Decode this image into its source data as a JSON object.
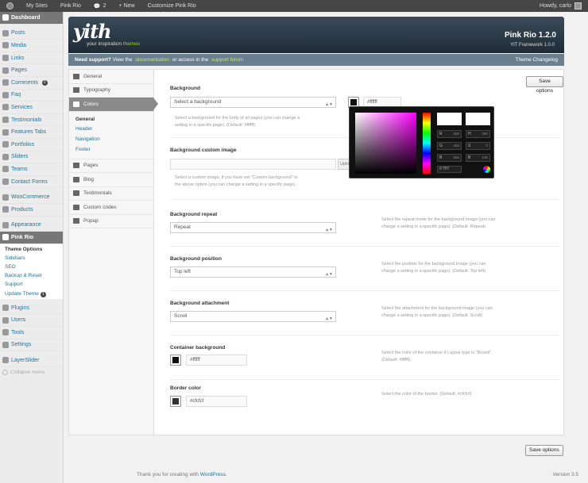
{
  "adminbar": {
    "my_sites": "My Sites",
    "site_name": "Pink Rio",
    "comments": "2",
    "new": "+ New",
    "customize": "Customize Pink Rio",
    "howdy": "Howdy, carlo"
  },
  "sidebar": {
    "items": [
      {
        "label": "Dashboard",
        "icon": "dashboard-icon"
      },
      {
        "label": "Posts",
        "icon": "pin-icon"
      },
      {
        "label": "Media",
        "icon": "media-icon"
      },
      {
        "label": "Links",
        "icon": "links-icon"
      },
      {
        "label": "Pages",
        "icon": "pages-icon"
      },
      {
        "label": "Comments",
        "icon": "comments-icon",
        "badge": "2"
      },
      {
        "label": "Faq",
        "icon": "question-icon"
      },
      {
        "label": "Services",
        "icon": "gear-icon"
      },
      {
        "label": "Testimonials",
        "icon": "quote-icon"
      },
      {
        "label": "Features Tabs",
        "icon": "tabs-icon"
      },
      {
        "label": "Portfolios",
        "icon": "folder-icon"
      },
      {
        "label": "Sliders",
        "icon": "slider-icon"
      },
      {
        "label": "Teams",
        "icon": "team-icon"
      },
      {
        "label": "Contact Forms",
        "icon": "mail-icon"
      },
      {
        "label": "WooCommerce",
        "icon": "woocommerce-icon"
      },
      {
        "label": "Products",
        "icon": "products-icon"
      },
      {
        "label": "Appearance",
        "icon": "appearance-icon"
      },
      {
        "label": "Pink Rio",
        "icon": "yith-icon"
      }
    ],
    "submenu": [
      "Theme Options",
      "Sidebars",
      "SEO",
      "Backup & Reset",
      "Support",
      "Update Theme"
    ],
    "update_badge": "1",
    "bottom": [
      {
        "label": "Plugins",
        "icon": "plugin-icon"
      },
      {
        "label": "Users",
        "icon": "users-icon"
      },
      {
        "label": "Tools",
        "icon": "tools-icon"
      },
      {
        "label": "Settings",
        "icon": "settings-icon"
      },
      {
        "label": "LayerSlider",
        "icon": "layerslider-icon"
      }
    ],
    "collapse": "Collapse menu"
  },
  "header": {
    "logo": "yith",
    "tagline_a": "your inspiration ",
    "tagline_b": "themes",
    "theme_version": "Pink Rio 1.2.0",
    "fw_version": "YIT Framework 1.0.0"
  },
  "support": {
    "lead": "Need support?",
    "text1": " View the ",
    "doc": "documentation",
    "text2": " or access in the ",
    "forum": "support forum",
    "changelog": "Theme Changelog"
  },
  "nav": {
    "general": "General",
    "typography": "Typography",
    "colors": "Colors",
    "sub": [
      "General",
      "Header",
      "Navigation",
      "Footer"
    ],
    "pages": "Pages",
    "blog": "Blog",
    "testimonials": "Testimonials",
    "custom_codes": "Custom codes",
    "popup": "Popup"
  },
  "buttons": {
    "save": "Save options"
  },
  "options": {
    "bg": {
      "title": "Background",
      "select": "Select a background",
      "desc": "Select a background for the body of all pages (you can change a setting in a specific page). (Default: #ffffff)",
      "color": "#ffffff"
    },
    "bg_image": {
      "title": "Background custom image",
      "upload": "Upload",
      "desc": "Select a custom image, if you have set \"Custom background\" in the above option (you can change a setting in a specific page)."
    },
    "bg_repeat": {
      "title": "Background repeat",
      "value": "Repeat",
      "desc": "Select the repeat mode for the background image (you can change a setting in a specific page). (Default: Repeat)"
    },
    "bg_position": {
      "title": "Background position",
      "value": "Top left",
      "desc": "Select the position for the background image (you can change a setting in a specific page). (Default: Top left)"
    },
    "bg_attach": {
      "title": "Background attachment",
      "value": "Scroll",
      "desc": "Select the attachment for the background image (you can change a setting in a specific page). (Default: Scroll)"
    },
    "container_bg": {
      "title": "Container background",
      "value": "#ffffff",
      "desc": "Select the color of the container if Layout type is \"Boxed\". (Default: #ffffff)"
    },
    "border": {
      "title": "Border color",
      "value": "#cfcfcf",
      "desc": "Select the color of the border. (Default: #cfcfcf)"
    }
  },
  "picker": {
    "r": "255",
    "g": "255",
    "b": "255",
    "h": "360",
    "s": "0",
    "b2": "100",
    "r_l": "R",
    "g_l": "G",
    "b_l": "B",
    "h_l": "H",
    "s_l": "S",
    "b2_l": "B",
    "hex": "#",
    "hex_val": "ffffff"
  },
  "footer": {
    "text": "Thank you for creating with ",
    "wp": "WordPress.",
    "version": "Version 3.5"
  }
}
